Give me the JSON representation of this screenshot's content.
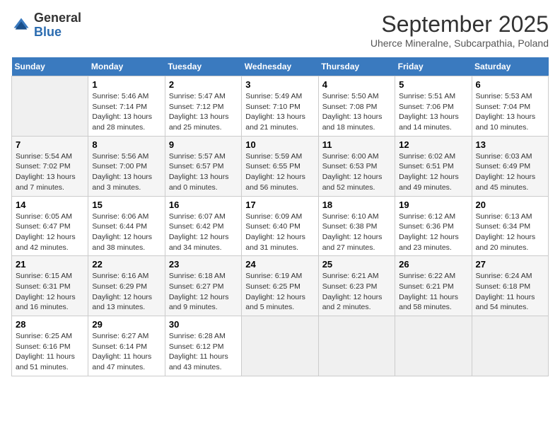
{
  "header": {
    "logo_line1": "General",
    "logo_line2": "Blue",
    "month": "September 2025",
    "location": "Uherce Mineralne, Subcarpathia, Poland"
  },
  "days_of_week": [
    "Sunday",
    "Monday",
    "Tuesday",
    "Wednesday",
    "Thursday",
    "Friday",
    "Saturday"
  ],
  "weeks": [
    [
      {
        "day": null
      },
      {
        "day": "1",
        "sunrise": "5:46 AM",
        "sunset": "7:14 PM",
        "daylight": "13 hours and 28 minutes."
      },
      {
        "day": "2",
        "sunrise": "5:47 AM",
        "sunset": "7:12 PM",
        "daylight": "13 hours and 25 minutes."
      },
      {
        "day": "3",
        "sunrise": "5:49 AM",
        "sunset": "7:10 PM",
        "daylight": "13 hours and 21 minutes."
      },
      {
        "day": "4",
        "sunrise": "5:50 AM",
        "sunset": "7:08 PM",
        "daylight": "13 hours and 18 minutes."
      },
      {
        "day": "5",
        "sunrise": "5:51 AM",
        "sunset": "7:06 PM",
        "daylight": "13 hours and 14 minutes."
      },
      {
        "day": "6",
        "sunrise": "5:53 AM",
        "sunset": "7:04 PM",
        "daylight": "13 hours and 10 minutes."
      }
    ],
    [
      {
        "day": "7",
        "sunrise": "5:54 AM",
        "sunset": "7:02 PM",
        "daylight": "13 hours and 7 minutes."
      },
      {
        "day": "8",
        "sunrise": "5:56 AM",
        "sunset": "7:00 PM",
        "daylight": "13 hours and 3 minutes."
      },
      {
        "day": "9",
        "sunrise": "5:57 AM",
        "sunset": "6:57 PM",
        "daylight": "13 hours and 0 minutes."
      },
      {
        "day": "10",
        "sunrise": "5:59 AM",
        "sunset": "6:55 PM",
        "daylight": "12 hours and 56 minutes."
      },
      {
        "day": "11",
        "sunrise": "6:00 AM",
        "sunset": "6:53 PM",
        "daylight": "12 hours and 52 minutes."
      },
      {
        "day": "12",
        "sunrise": "6:02 AM",
        "sunset": "6:51 PM",
        "daylight": "12 hours and 49 minutes."
      },
      {
        "day": "13",
        "sunrise": "6:03 AM",
        "sunset": "6:49 PM",
        "daylight": "12 hours and 45 minutes."
      }
    ],
    [
      {
        "day": "14",
        "sunrise": "6:05 AM",
        "sunset": "6:47 PM",
        "daylight": "12 hours and 42 minutes."
      },
      {
        "day": "15",
        "sunrise": "6:06 AM",
        "sunset": "6:44 PM",
        "daylight": "12 hours and 38 minutes."
      },
      {
        "day": "16",
        "sunrise": "6:07 AM",
        "sunset": "6:42 PM",
        "daylight": "12 hours and 34 minutes."
      },
      {
        "day": "17",
        "sunrise": "6:09 AM",
        "sunset": "6:40 PM",
        "daylight": "12 hours and 31 minutes."
      },
      {
        "day": "18",
        "sunrise": "6:10 AM",
        "sunset": "6:38 PM",
        "daylight": "12 hours and 27 minutes."
      },
      {
        "day": "19",
        "sunrise": "6:12 AM",
        "sunset": "6:36 PM",
        "daylight": "12 hours and 23 minutes."
      },
      {
        "day": "20",
        "sunrise": "6:13 AM",
        "sunset": "6:34 PM",
        "daylight": "12 hours and 20 minutes."
      }
    ],
    [
      {
        "day": "21",
        "sunrise": "6:15 AM",
        "sunset": "6:31 PM",
        "daylight": "12 hours and 16 minutes."
      },
      {
        "day": "22",
        "sunrise": "6:16 AM",
        "sunset": "6:29 PM",
        "daylight": "12 hours and 13 minutes."
      },
      {
        "day": "23",
        "sunrise": "6:18 AM",
        "sunset": "6:27 PM",
        "daylight": "12 hours and 9 minutes."
      },
      {
        "day": "24",
        "sunrise": "6:19 AM",
        "sunset": "6:25 PM",
        "daylight": "12 hours and 5 minutes."
      },
      {
        "day": "25",
        "sunrise": "6:21 AM",
        "sunset": "6:23 PM",
        "daylight": "12 hours and 2 minutes."
      },
      {
        "day": "26",
        "sunrise": "6:22 AM",
        "sunset": "6:21 PM",
        "daylight": "11 hours and 58 minutes."
      },
      {
        "day": "27",
        "sunrise": "6:24 AM",
        "sunset": "6:18 PM",
        "daylight": "11 hours and 54 minutes."
      }
    ],
    [
      {
        "day": "28",
        "sunrise": "6:25 AM",
        "sunset": "6:16 PM",
        "daylight": "11 hours and 51 minutes."
      },
      {
        "day": "29",
        "sunrise": "6:27 AM",
        "sunset": "6:14 PM",
        "daylight": "11 hours and 47 minutes."
      },
      {
        "day": "30",
        "sunrise": "6:28 AM",
        "sunset": "6:12 PM",
        "daylight": "11 hours and 43 minutes."
      },
      {
        "day": null
      },
      {
        "day": null
      },
      {
        "day": null
      },
      {
        "day": null
      }
    ]
  ],
  "labels": {
    "sunrise": "Sunrise:",
    "sunset": "Sunset:",
    "daylight": "Daylight:"
  }
}
